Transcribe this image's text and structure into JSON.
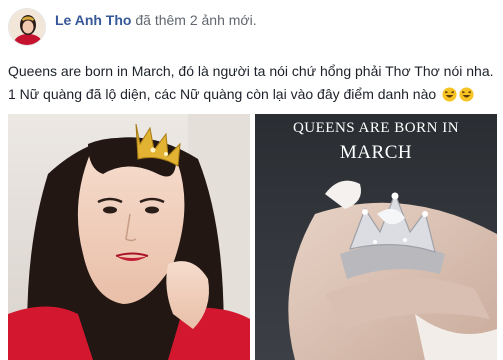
{
  "post": {
    "author": "Le Anh Tho",
    "action": "đã thêm 2 ảnh mới.",
    "text_line1": "Queens are born in March, đó là người ta nói chứ hổng phải Thơ Thơ nói nha.",
    "text_line2": "1 Nữ quàng đã lộ diện, các Nữ quàng còn lại vào đây điểm danh nào",
    "emojis": [
      "laughing-emoji",
      "laughing-emoji"
    ]
  },
  "photos": {
    "right_title_line1": "QUEENS ARE BORN IN",
    "right_title_line2": "MARCH"
  },
  "colors": {
    "author_link": "#365899",
    "meta_gray": "#616770",
    "text": "#1d2129"
  }
}
